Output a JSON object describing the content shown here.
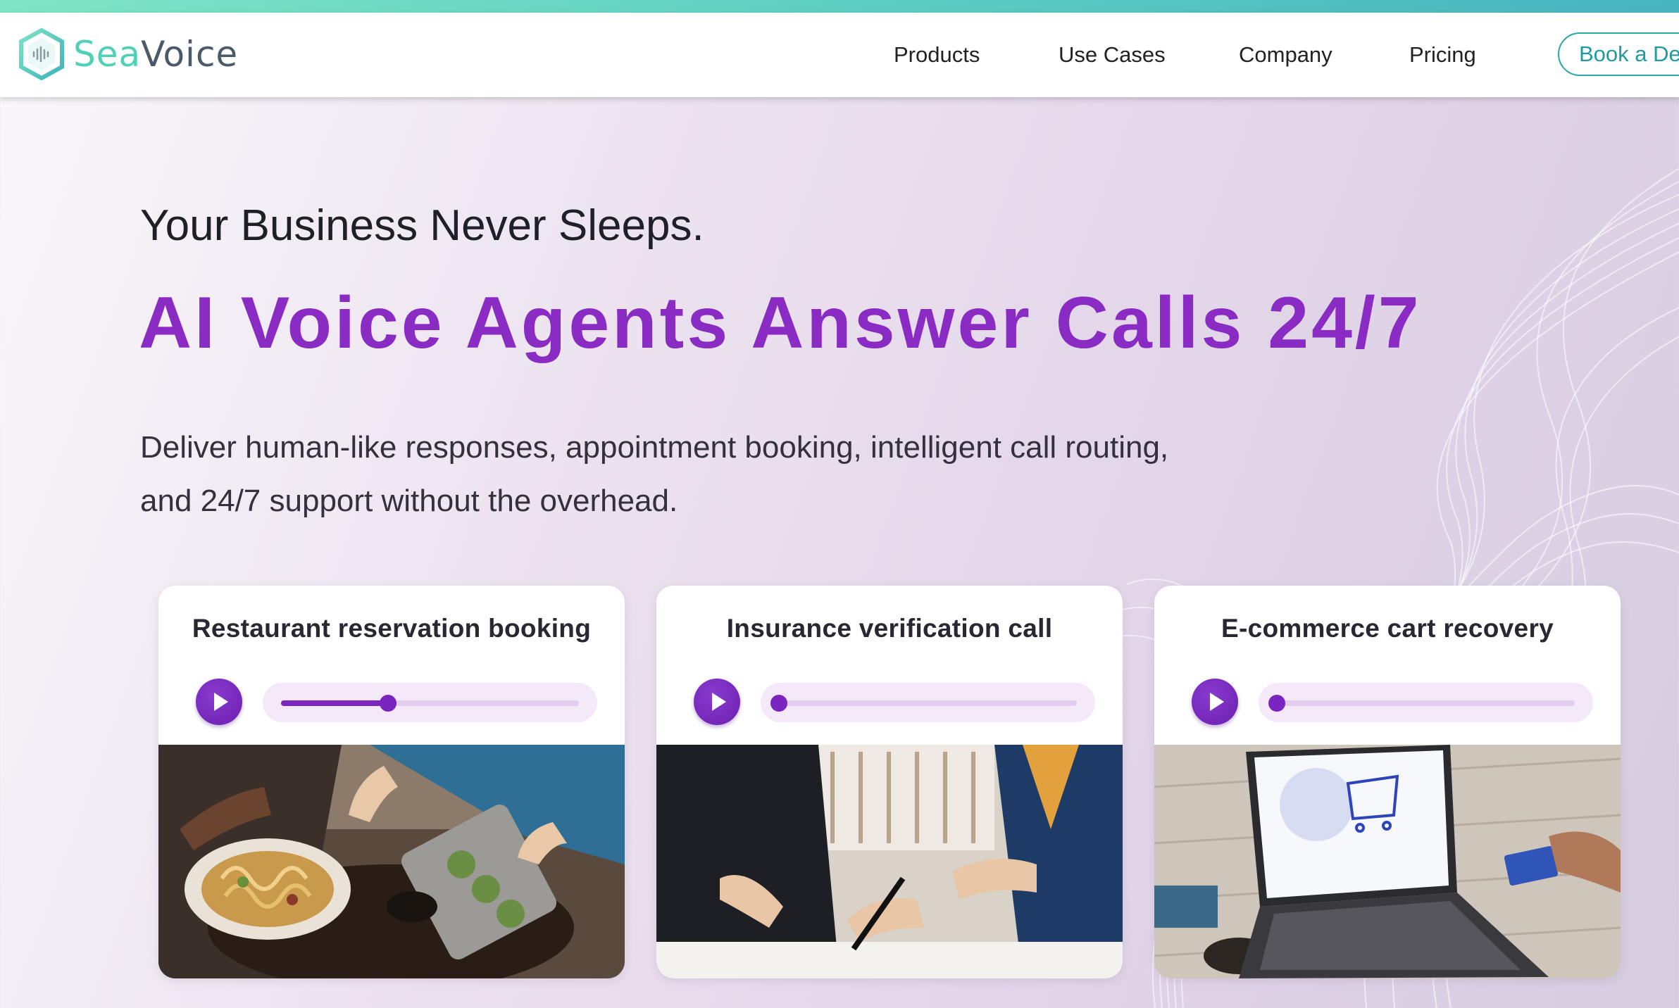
{
  "brand": {
    "name_part1": "Sea",
    "name_part2": "Voice",
    "accent_teal": "#4fd1b5",
    "accent_purple": "#8a2bc4"
  },
  "nav": {
    "items": [
      "Products",
      "Use Cases",
      "Company",
      "Pricing"
    ],
    "cta_label": "Book a Demo"
  },
  "hero": {
    "eyebrow": "Your Business Never Sleeps.",
    "headline": "AI Voice Agents Answer Calls 24/7",
    "description_line1": "Deliver human-like responses, appointment booking, intelligent call routing,",
    "description_line2": "and 24/7 support without the overhead."
  },
  "demos": [
    {
      "title": "Restaurant reservation booking",
      "progress": 0.36,
      "image": "restaurant-dining-photo"
    },
    {
      "title": "Insurance verification call",
      "progress": 0.0,
      "image": "document-signing-photo"
    },
    {
      "title": "E-commerce cart recovery",
      "progress": 0.0,
      "image": "laptop-shopping-photo"
    }
  ]
}
